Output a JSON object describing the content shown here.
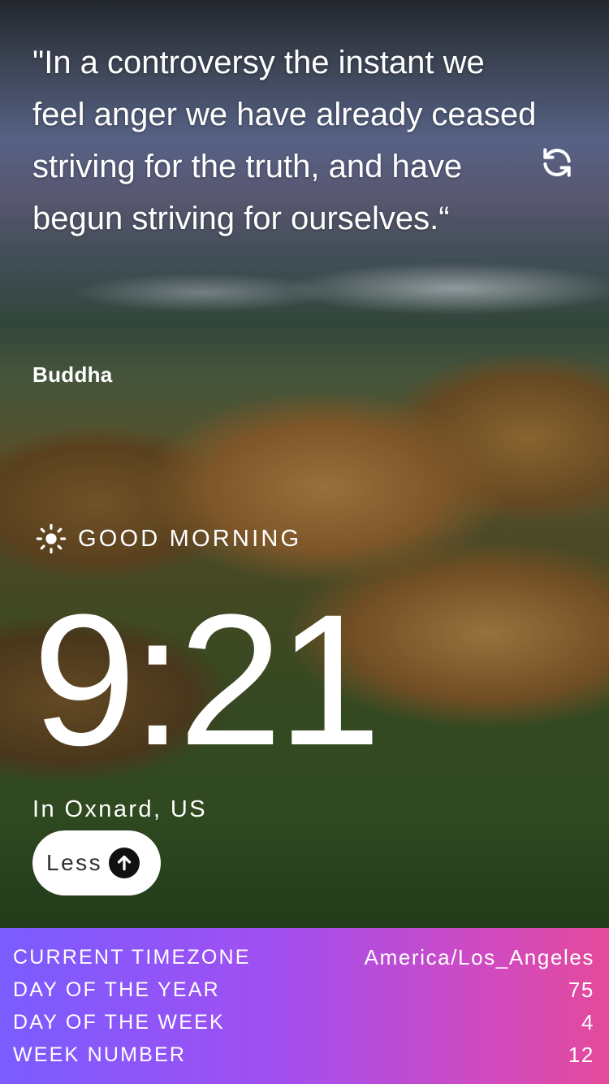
{
  "quote": {
    "text": "\"In a controversy the instant we feel anger we have already ceased striving for the truth, and have begun striving for ourselves.“",
    "author": "Buddha",
    "refresh_icon": "refresh-icon"
  },
  "greeting": {
    "icon": "sun-icon",
    "text": "GOOD MORNING"
  },
  "clock": {
    "time": "9:21",
    "location": "In Oxnard, US"
  },
  "toggle": {
    "label": "Less",
    "icon": "arrow-up-circle-icon"
  },
  "details": {
    "rows": [
      {
        "label": "CURRENT TIMEZONE",
        "value": "America/Los_Angeles"
      },
      {
        "label": "DAY OF THE YEAR",
        "value": "75"
      },
      {
        "label": "DAY OF THE WEEK",
        "value": "4"
      },
      {
        "label": "WEEK NUMBER",
        "value": "12"
      }
    ]
  },
  "colors": {
    "panel_gradient_start": "#7a5cff",
    "panel_gradient_end": "#e44a9b",
    "button_bg": "#ffffff"
  }
}
